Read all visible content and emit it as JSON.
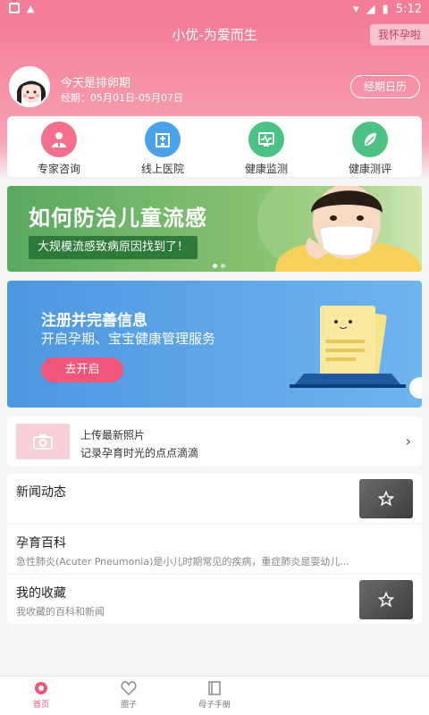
{
  "status": {
    "time": "5:12"
  },
  "app": {
    "title": "小优-为爱而生",
    "pregnant_button": "我怀孕啦"
  },
  "period": {
    "title": "今天是排卵期",
    "range": "经期：05月01日-05月07日",
    "calendar_button": "经期日历"
  },
  "quick_actions": [
    {
      "label": "专家咨询",
      "icon": "doctor-icon",
      "color": "#f36f8c"
    },
    {
      "label": "线上医院",
      "icon": "hospital-icon",
      "color": "#4aa3e8"
    },
    {
      "label": "健康监测",
      "icon": "monitor-icon",
      "color": "#4cc184"
    },
    {
      "label": "健康测评",
      "icon": "leaf-icon",
      "color": "#4cc184"
    }
  ],
  "banner1": {
    "title": "如何防治儿童流感",
    "subtitle": "大规模流感致病原因找到了！"
  },
  "banner2": {
    "title": "注册并完善信息",
    "subtitle": "开启孕期、宝宝健康管理服务",
    "button": "去开启"
  },
  "upload": {
    "title": "上传最新照片",
    "subtitle": "记录孕育时光的点点滴滴"
  },
  "list": [
    {
      "title": "新闻动态",
      "subtitle": ""
    },
    {
      "title": "孕育百科",
      "subtitle": "急性肺炎(Acuter Pneumonia)是小儿时期常见的疾病，重症肺炎是婴幼儿..."
    },
    {
      "title": "我的收藏",
      "subtitle": "我收藏的百科和新闻"
    }
  ],
  "tabs": [
    {
      "label": "首页"
    },
    {
      "label": "圈子"
    },
    {
      "label": "母子手册"
    }
  ],
  "colors": {
    "brand_pink": "#f47c97",
    "accent": "#f0567a"
  }
}
